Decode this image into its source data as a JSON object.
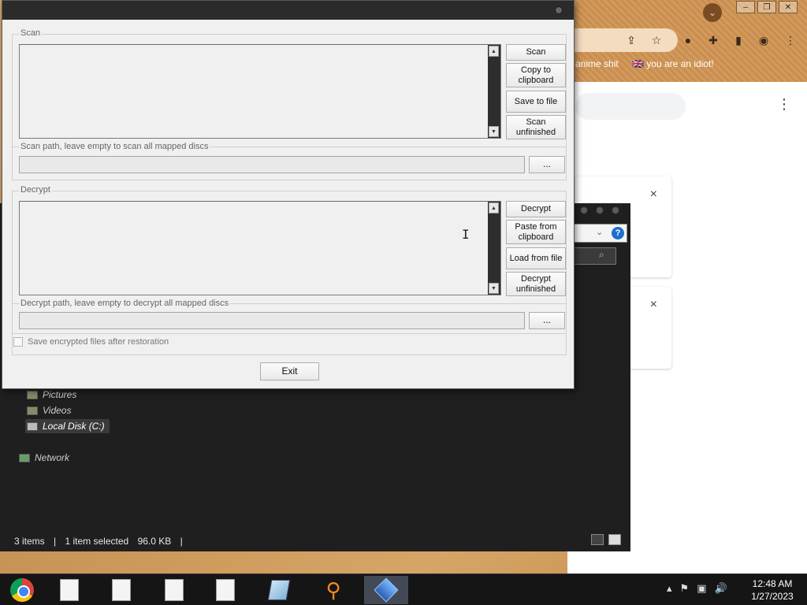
{
  "browser": {
    "bookmarks": [
      "h anime shit",
      "you are an idiot!"
    ],
    "icons": [
      "share-icon",
      "star-icon",
      "extensions-icon",
      "sidebar-icon",
      "profile-icon",
      "menu-icon"
    ],
    "close_glyph": "×",
    "menu_glyph": "⋮"
  },
  "explorer": {
    "nav_items": [
      "Pictures",
      "Videos",
      "Local Disk (C:)",
      "Network"
    ],
    "status": {
      "items": "3 items",
      "selected": "1 item selected",
      "size": "96.0 KB"
    },
    "help_glyph": "?"
  },
  "dialog": {
    "scan_group": {
      "legend": "Scan",
      "buttons": [
        "Scan",
        "Copy to clipboard",
        "Save to file",
        "Scan unfinished"
      ],
      "path_label": "Scan path, leave empty to scan all mapped discs",
      "path_value": "",
      "browse_label": "..."
    },
    "decrypt_group": {
      "legend": "Decrypt",
      "buttons": [
        "Decrypt",
        "Paste from clipboard",
        "Load from file",
        "Decrypt unfinished"
      ],
      "path_label": "Decrypt path, leave empty to decrypt all mapped discs",
      "path_value": "",
      "browse_label": "..."
    },
    "save_encrypted_label": "Save encrypted files after restoration",
    "save_encrypted_checked": false,
    "exit_label": "Exit"
  },
  "taskbar": {
    "apps": [
      "chrome-icon",
      "document-icon",
      "document-icon",
      "document-icon",
      "document-icon",
      "notepad-icon",
      "search-app-icon",
      "decryptor-icon"
    ],
    "clock_time": "12:48 AM",
    "clock_date": "1/27/2023"
  }
}
